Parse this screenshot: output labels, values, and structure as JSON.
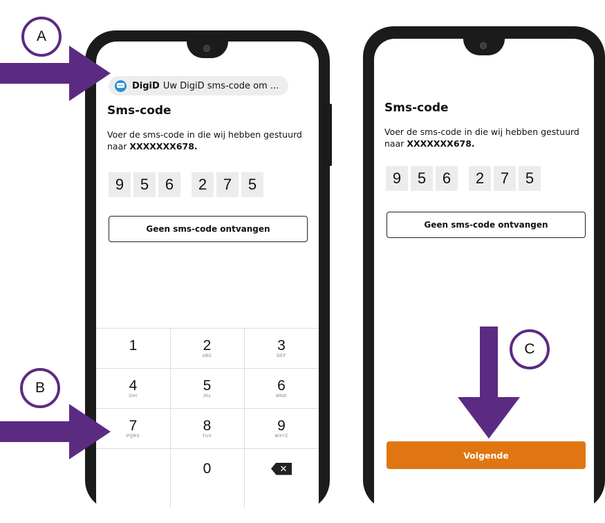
{
  "notification": {
    "app": "DigiD",
    "text": "Uw DigiD sms-code om ..."
  },
  "left_screen": {
    "title": "Sms-code",
    "desc_text": "Voer de sms-code in die wij hebben gestuurd naar ",
    "phone_masked": "XXXXXXX678.",
    "digits": [
      "9",
      "5",
      "6",
      "2",
      "7",
      "5"
    ],
    "no_code_button": "Geen sms-code ontvangen"
  },
  "keypad": {
    "keys": [
      {
        "n": "1",
        "l": ""
      },
      {
        "n": "2",
        "l": "ABC"
      },
      {
        "n": "3",
        "l": "DEF"
      },
      {
        "n": "4",
        "l": "GHI"
      },
      {
        "n": "5",
        "l": "JKL"
      },
      {
        "n": "6",
        "l": "MNO"
      },
      {
        "n": "7",
        "l": "PQRS"
      },
      {
        "n": "8",
        "l": "TUV"
      },
      {
        "n": "9",
        "l": "WXYZ"
      },
      {
        "n": "",
        "l": ""
      },
      {
        "n": "0",
        "l": ""
      }
    ],
    "backspace_icon": "backspace-icon"
  },
  "right_screen": {
    "title": "Sms-code",
    "desc_text": "Voer de sms-code in die wij hebben gestuurd naar ",
    "phone_masked": "XXXXXXX678.",
    "digits": [
      "9",
      "5",
      "6",
      "2",
      "7",
      "5"
    ],
    "no_code_button": "Geen sms-code ontvangen",
    "next_button": "Volgende"
  },
  "callouts": {
    "a": "A",
    "b": "B",
    "c": "C"
  },
  "colors": {
    "accent_purple": "#5b2b82",
    "button_orange": "#e07612",
    "notification_icon_blue": "#2f8fd8"
  }
}
